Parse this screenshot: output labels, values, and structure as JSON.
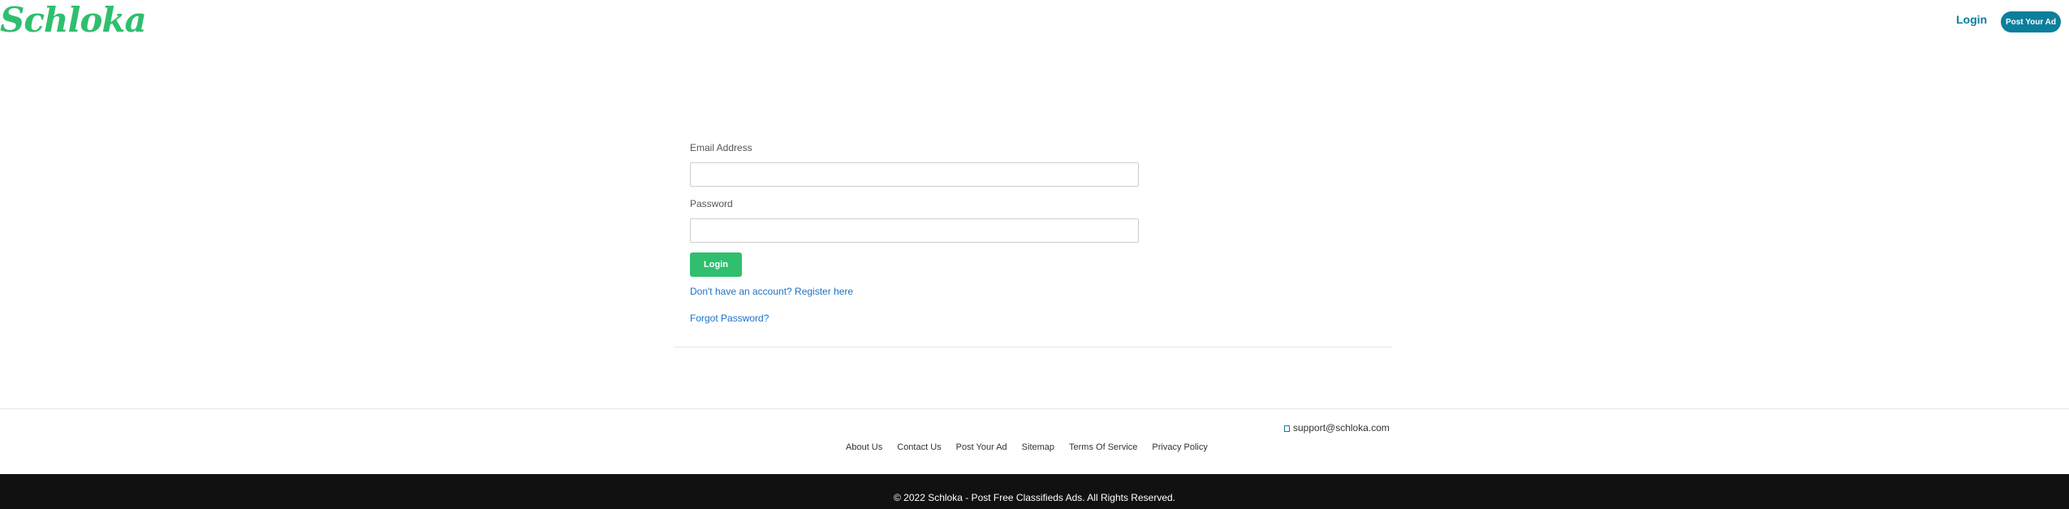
{
  "header": {
    "logo": "Schloka",
    "login_label": "Login",
    "post_ad_label": "Post Your Ad"
  },
  "form": {
    "email_label": "Email Address",
    "email_value": "",
    "password_label": "Password",
    "password_value": "",
    "login_button": "Login",
    "register_link": "Don't have an account? Register here",
    "forgot_link": "Forgot Password?"
  },
  "footer": {
    "support_email": "support@schloka.com",
    "links": [
      "About Us",
      "Contact Us",
      "Post Your Ad",
      "Sitemap",
      "Terms Of Service",
      "Privacy Policy"
    ],
    "copyright": "© 2022 Schloka - Post Free Classifieds Ads. All Rights Reserved."
  },
  "colors": {
    "brand_green": "#2fbf6e",
    "accent_teal": "#0a7f9c",
    "link_blue": "#1a73c8",
    "footer_dark": "#111111"
  }
}
